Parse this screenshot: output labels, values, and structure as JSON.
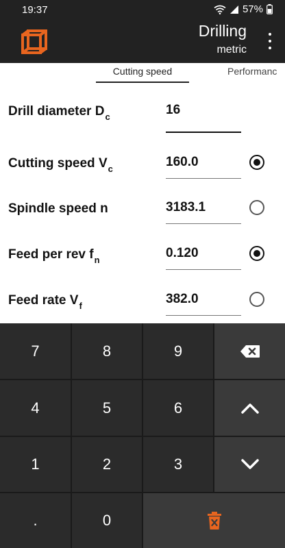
{
  "status": {
    "time": "19:37",
    "battery": "57%"
  },
  "app": {
    "title": "Drilling",
    "subtitle": "metric",
    "accent": "#e8651f"
  },
  "tabs": [
    {
      "label": "Cutting speed"
    },
    {
      "label": "Performanc"
    }
  ],
  "fields": [
    {
      "label": "Drill diameter D",
      "sub": "c",
      "value": "16",
      "radio": null
    },
    {
      "label": "Cutting speed V",
      "sub": "c",
      "value": "160.0",
      "radio": "checked"
    },
    {
      "label": "Spindle speed n",
      "sub": "",
      "value": "3183.1",
      "radio": "unchecked"
    },
    {
      "label": "Feed per rev f",
      "sub": "n",
      "value": "0.120",
      "radio": "checked"
    },
    {
      "label": "Feed rate V",
      "sub": "f",
      "value": "382.0",
      "radio": "unchecked"
    }
  ],
  "keypad": {
    "keys": [
      "7",
      "8",
      "9",
      "4",
      "5",
      "6",
      "1",
      "2",
      "3",
      ".",
      "0"
    ],
    "icons": [
      "backspace-icon",
      "arrow-up-icon",
      "arrow-down-icon",
      "trash-icon"
    ]
  }
}
